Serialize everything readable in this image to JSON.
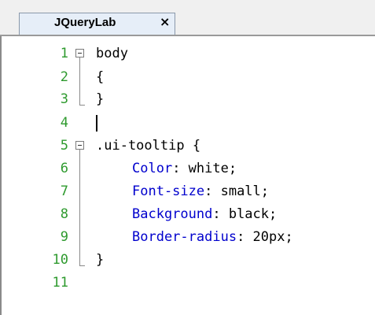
{
  "tab": {
    "label": "JQueryLab",
    "close": "×"
  },
  "gutter": [
    "1",
    "2",
    "3",
    "4",
    "5",
    "6",
    "7",
    "8",
    "9",
    "10",
    "11"
  ],
  "code": {
    "line1": "body",
    "line2": "{",
    "line3": "}",
    "line5": ".ui-tooltip {",
    "line6_prop": "Color",
    "line6_val": ": white;",
    "line7_prop": "Font-size",
    "line7_val": ": small;",
    "line8_prop": "Background",
    "line8_val": ": black;",
    "line9_prop": "Border-radius",
    "line9_val": ": 20px;",
    "line10": "}"
  },
  "colors": {
    "line_number": "#2e9a2e",
    "property": "#0000cd",
    "text": "#000000",
    "tab_background": "#e6eef8"
  },
  "icons": {
    "fold": "collapse-box-icon"
  }
}
